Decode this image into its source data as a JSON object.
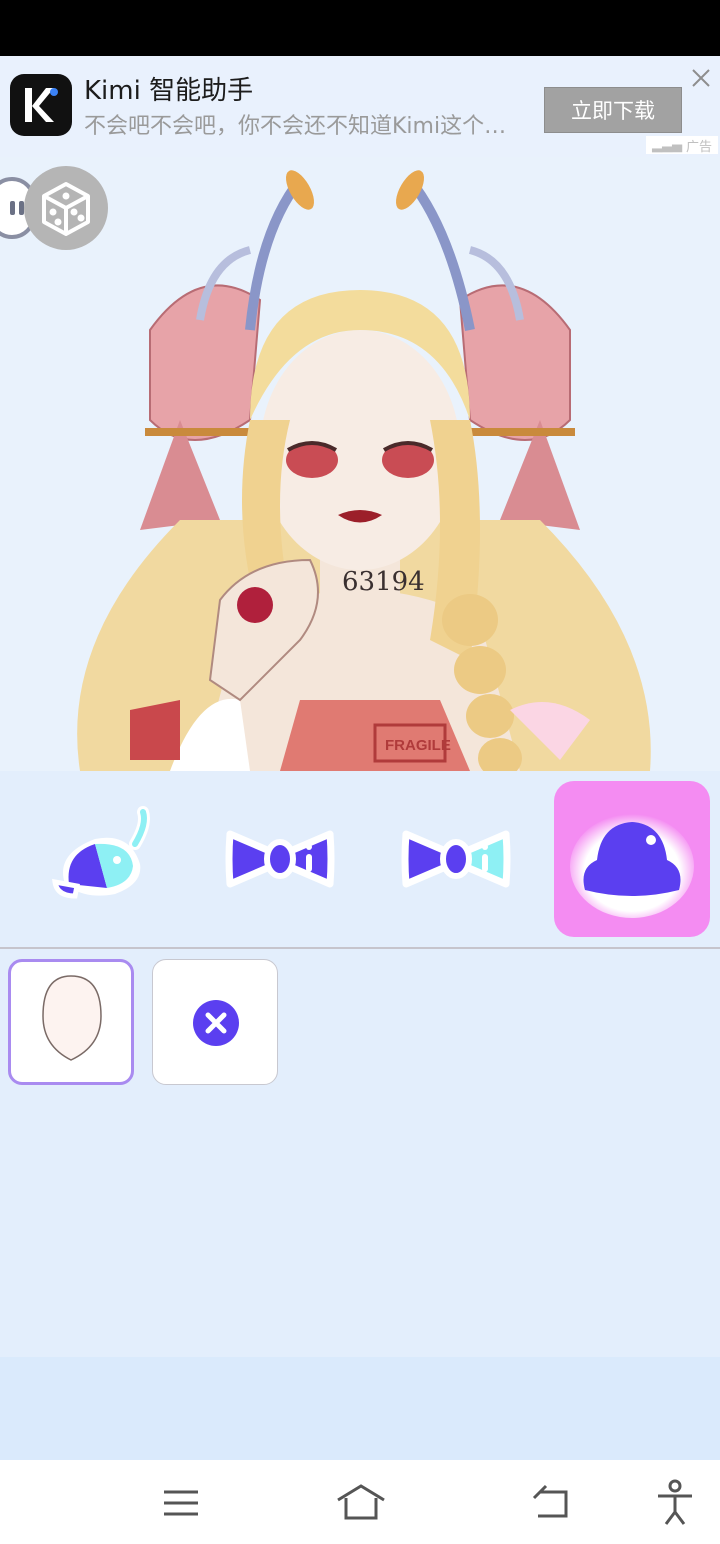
{
  "ad": {
    "app_name": "Kimi 智能助手",
    "subtitle": "不会吧不会吧，你不会还不知道Kimi这个…",
    "download_label": "立即下载",
    "ad_tag": "广告",
    "logo_letter": "K"
  },
  "character": {
    "neck_number": "63194",
    "stamp_text": "FRAGILE"
  },
  "tabs": [
    {
      "name": "hat-category",
      "selected": false
    },
    {
      "name": "bow-category",
      "selected": false
    },
    {
      "name": "bow-two-tone-category",
      "selected": false
    },
    {
      "name": "headwear-category",
      "selected": true
    }
  ],
  "options": [
    {
      "name": "face-base-option",
      "selected": true
    },
    {
      "name": "remove-option",
      "selected": false
    }
  ],
  "colors": {
    "accent_purple": "#5b3ff0",
    "selected_tab_bg": "#f48cf2",
    "selected_outline": "#a98bf0",
    "panel_bg": "#e3eefc"
  },
  "navbar": [
    "menu",
    "home",
    "back",
    "accessibility"
  ]
}
